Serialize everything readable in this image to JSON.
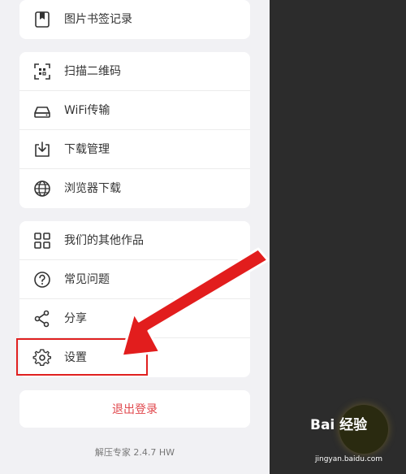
{
  "menu_groups": [
    {
      "items": [
        {
          "label": "图片书签记录",
          "icon": "bookmark-icon"
        }
      ]
    },
    {
      "items": [
        {
          "label": "扫描二维码",
          "icon": "qr-scan-icon"
        },
        {
          "label": "WiFi传输",
          "icon": "wifi-drive-icon"
        },
        {
          "label": "下载管理",
          "icon": "download-manager-icon"
        },
        {
          "label": "浏览器下载",
          "icon": "globe-icon"
        }
      ]
    },
    {
      "items": [
        {
          "label": "我们的其他作品",
          "icon": "grid-apps-icon"
        },
        {
          "label": "常见问题",
          "icon": "question-icon"
        },
        {
          "label": "分享",
          "icon": "share-icon"
        },
        {
          "label": "设置",
          "icon": "gear-icon"
        }
      ]
    }
  ],
  "logout_label": "退出登录",
  "version_text": "解压专家 2.4.7 HW",
  "watermark": {
    "brand": "Bai 经验",
    "url": "jingyan.baidu.com"
  },
  "colors": {
    "drawer_bg": "#f1f1f4",
    "overlay_bg": "#2c2c2c",
    "logout_text": "#e0474c",
    "annotation_red": "#e02020"
  }
}
